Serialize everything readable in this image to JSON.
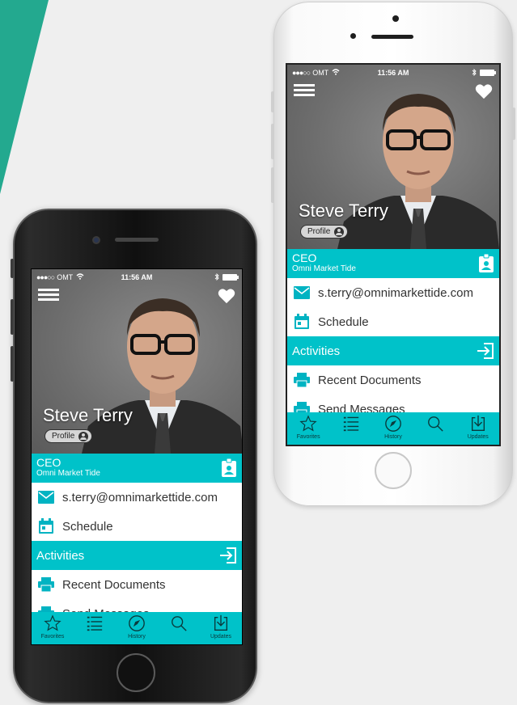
{
  "app": {
    "status": {
      "signal": "●●●○○",
      "carrier": "OMT",
      "time": "11:56 AM"
    },
    "profile": {
      "name": "Steve Terry",
      "profile_label": "Profile",
      "role": "CEO",
      "company": "Omni Market Tide"
    },
    "contact_rows": [
      {
        "icon": "mail-icon",
        "label": "s.terry@omnimarkettide.com"
      },
      {
        "icon": "calendar-icon",
        "label": "Schedule"
      }
    ],
    "activities": {
      "title": "Activities",
      "items": [
        {
          "icon": "printer-icon",
          "label": "Recent Documents"
        },
        {
          "icon": "printer-icon",
          "label": "Send Messages"
        }
      ]
    },
    "tabs": [
      {
        "icon": "star-icon",
        "label": "Favorites"
      },
      {
        "icon": "list-icon",
        "label": ""
      },
      {
        "icon": "compass-icon",
        "label": "History"
      },
      {
        "icon": "search-icon",
        "label": ""
      },
      {
        "icon": "download-icon",
        "label": "Updates"
      }
    ]
  },
  "colors": {
    "accent": "#00c2c9",
    "brand_green": "#23a98f",
    "hero_gray": "#6e6e6e"
  }
}
